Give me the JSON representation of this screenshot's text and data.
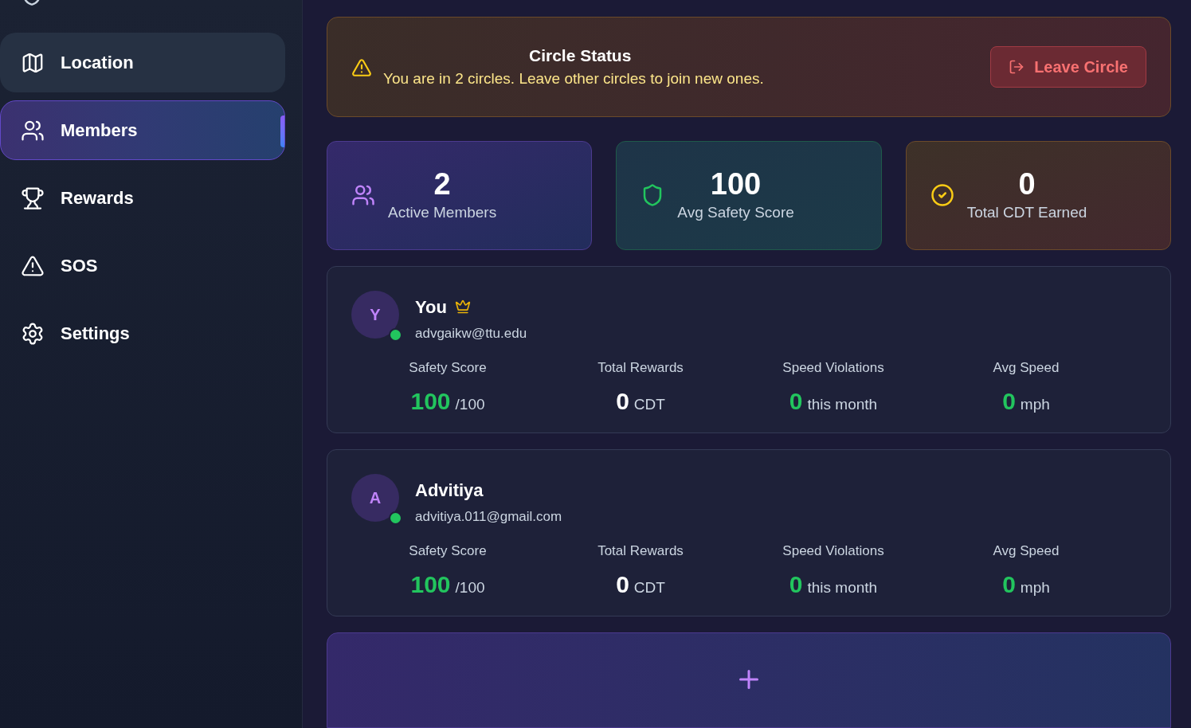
{
  "sidebar": {
    "items": [
      {
        "label": "Location",
        "kind": "map",
        "selected": false,
        "hovered": true
      },
      {
        "label": "Members",
        "kind": "users",
        "selected": true,
        "hovered": false
      },
      {
        "label": "Rewards",
        "kind": "trophy",
        "selected": false,
        "hovered": false
      },
      {
        "label": "SOS",
        "kind": "alert",
        "selected": false,
        "hovered": false
      },
      {
        "label": "Settings",
        "kind": "gear",
        "selected": false,
        "hovered": false
      }
    ]
  },
  "circle_status": {
    "title": "Circle Status",
    "message": "You are in 2 circles. Leave other circles to join new ones.",
    "button": "Leave Circle"
  },
  "stats": [
    {
      "kind": "members",
      "value": "2",
      "label": "Active Members"
    },
    {
      "kind": "safety",
      "value": "100",
      "label": "Avg Safety Score"
    },
    {
      "kind": "rewards",
      "value": "0",
      "label": "Total CDT Earned"
    }
  ],
  "members": [
    {
      "initial": "Y",
      "name": "You",
      "owner": true,
      "online": true,
      "email": "advgaikw@ttu.edu",
      "metrics": [
        {
          "label": "Safety Score",
          "value": "100",
          "unit": "/100",
          "color": "#22c55e"
        },
        {
          "label": "Total Rewards",
          "value": "0",
          "unit": "CDT",
          "color": "#ffffff"
        },
        {
          "label": "Speed Violations",
          "value": "0",
          "unit": "this month",
          "color": "#22c55e"
        },
        {
          "label": "Avg Speed",
          "value": "0",
          "unit": "mph",
          "color": "#22c55e"
        }
      ]
    },
    {
      "initial": "A",
      "name": "Advitiya",
      "owner": false,
      "online": true,
      "email": "advitiya.011@gmail.com",
      "metrics": [
        {
          "label": "Safety Score",
          "value": "100",
          "unit": "/100",
          "color": "#22c55e"
        },
        {
          "label": "Total Rewards",
          "value": "0",
          "unit": "CDT",
          "color": "#ffffff"
        },
        {
          "label": "Speed Violations",
          "value": "0",
          "unit": "this month",
          "color": "#22c55e"
        },
        {
          "label": "Avg Speed",
          "value": "0",
          "unit": "mph",
          "color": "#22c55e"
        }
      ]
    }
  ]
}
